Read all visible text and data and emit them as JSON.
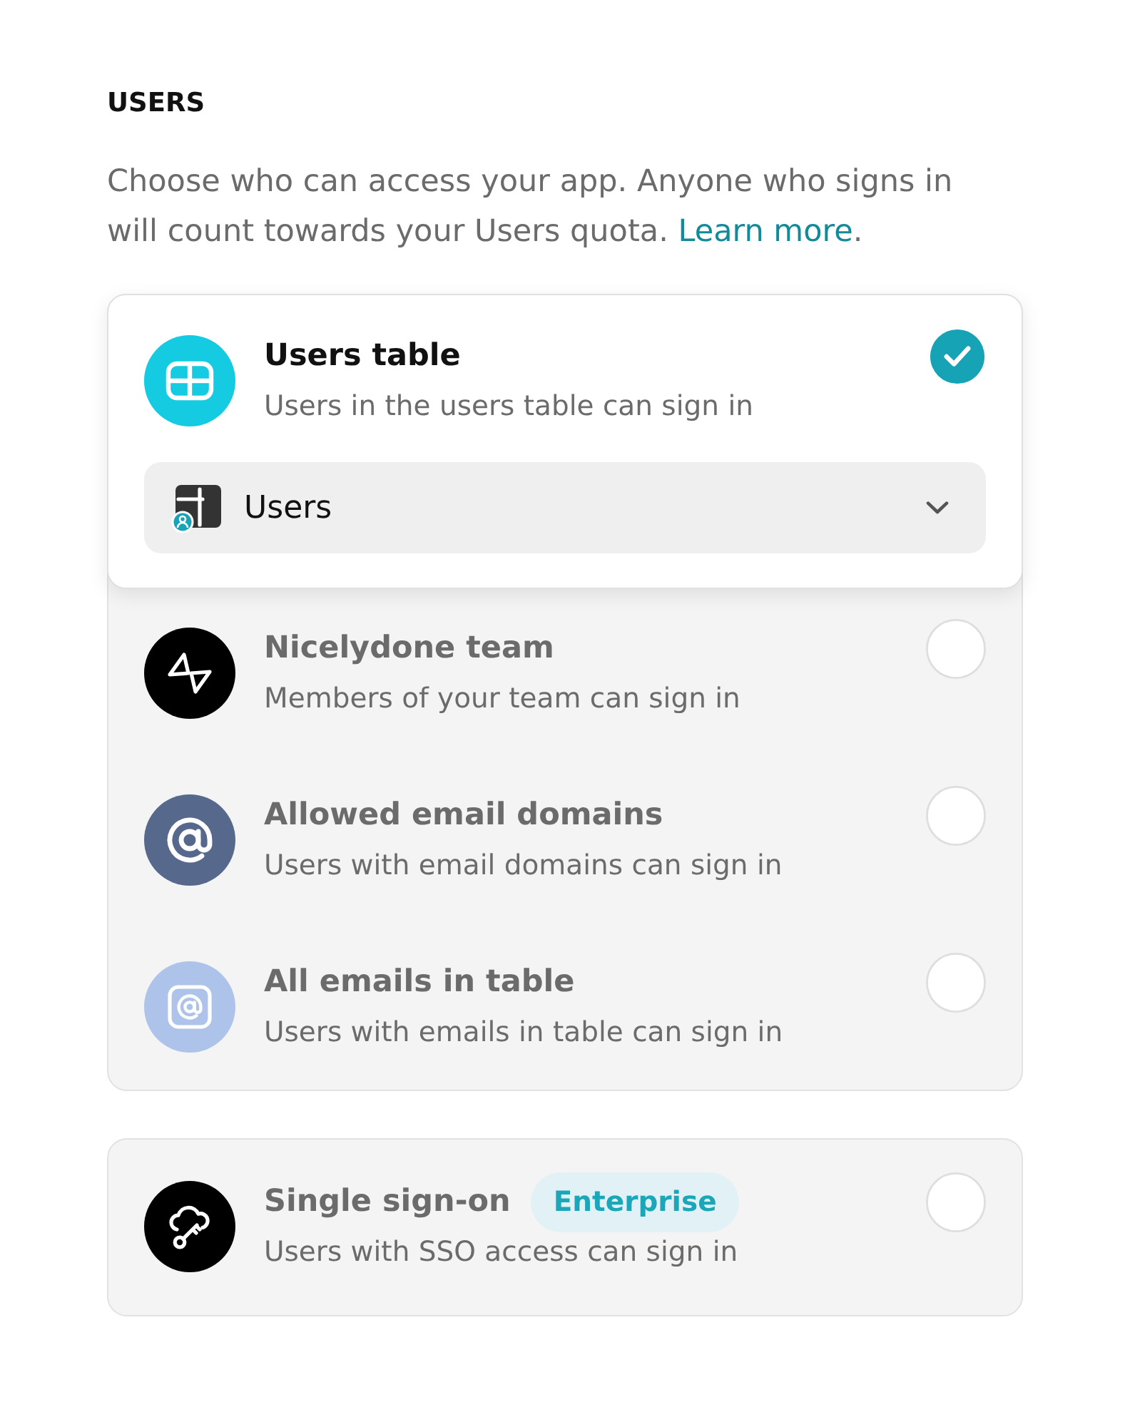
{
  "section": {
    "title": "USERS",
    "description": "Choose who can access your app. Anyone who signs in will count towards your Users quota.",
    "link": "Learn more",
    "link_suffix": "."
  },
  "groups": [
    {
      "options": [
        {
          "kind": "table",
          "title": "Users table",
          "subtitle": "Users in the users table can sign in",
          "color": "#14cbe2",
          "selected": true,
          "dropdown": {
            "value": "Users"
          }
        },
        {
          "kind": "team",
          "title": "Nicelydone team",
          "subtitle": "Members of your team can sign in",
          "color": "#000000",
          "selected": false
        },
        {
          "kind": "domains",
          "title": "Allowed email domains",
          "subtitle": "Users with email domains can sign in",
          "color": "#56698c",
          "selected": false
        },
        {
          "kind": "emails",
          "title": "All emails in table",
          "subtitle": "Users with emails in table can sign in",
          "color": "#aec3e9",
          "selected": false
        }
      ]
    },
    {
      "options": [
        {
          "kind": "sso",
          "title": "Single sign-on",
          "badge": "Enterprise",
          "subtitle": "Users with SSO access can sign in",
          "color": "#000000",
          "selected": false
        }
      ]
    }
  ]
}
